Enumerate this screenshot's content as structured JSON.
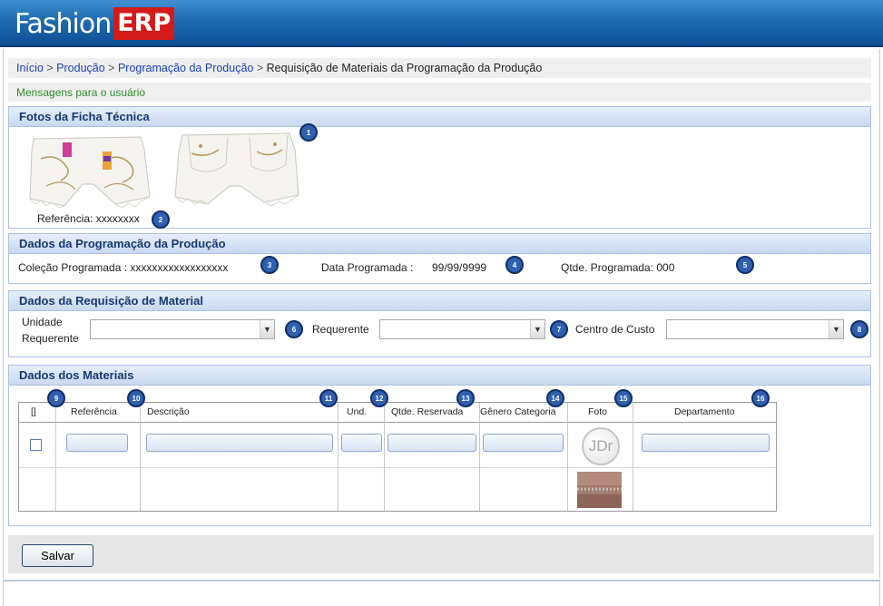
{
  "app": {
    "logo_fashion": "Fashion",
    "logo_erp": "ERP"
  },
  "breadcrumb": {
    "items": [
      "Início",
      "Produção",
      "Programação da Produção"
    ],
    "current": "Requisição de Materiais da Programação da Produção",
    "separator": ">"
  },
  "messages": {
    "text": "Mensagens para o usuário"
  },
  "fotos_panel": {
    "title": "Fotos da Ficha Técnica",
    "referencia_label": "Referência: xxxxxxxx"
  },
  "programacao_panel": {
    "title": "Dados da Programação da Produção",
    "colecao_label": "Coleção Programada : xxxxxxxxxxxxxxxxxx",
    "data_label": "Data Programada :",
    "data_value": "99/99/9999",
    "qtde_label": "Qtde. Programada: 000"
  },
  "requisicao_panel": {
    "title": "Dados da Requisição de Material",
    "unidade_label_1": "Unidade",
    "unidade_label_2": "Requerente",
    "requerente_label": "Requerente",
    "centro_label": "Centro de Custo"
  },
  "materiais_panel": {
    "title": "Dados dos Materiais",
    "columns": [
      "[]",
      "Referência",
      "Descrição",
      "Und.",
      "Qtde. Reservada",
      "Gênero Categoria",
      "Foto",
      "Departamento"
    ],
    "photo_logo": "JDr"
  },
  "badges": [
    "1",
    "2",
    "3",
    "4",
    "5",
    "6",
    "7",
    "8",
    "9",
    "10",
    "11",
    "12",
    "13",
    "14",
    "15",
    "16"
  ],
  "actions": {
    "save_label": "Salvar"
  },
  "colors": {
    "accent": "#2f5fb0",
    "header_blue": "#1f6bb0",
    "link": "#1b3fbf",
    "message_green": "#2e8b2e",
    "brand_red": "#d51a1a"
  }
}
